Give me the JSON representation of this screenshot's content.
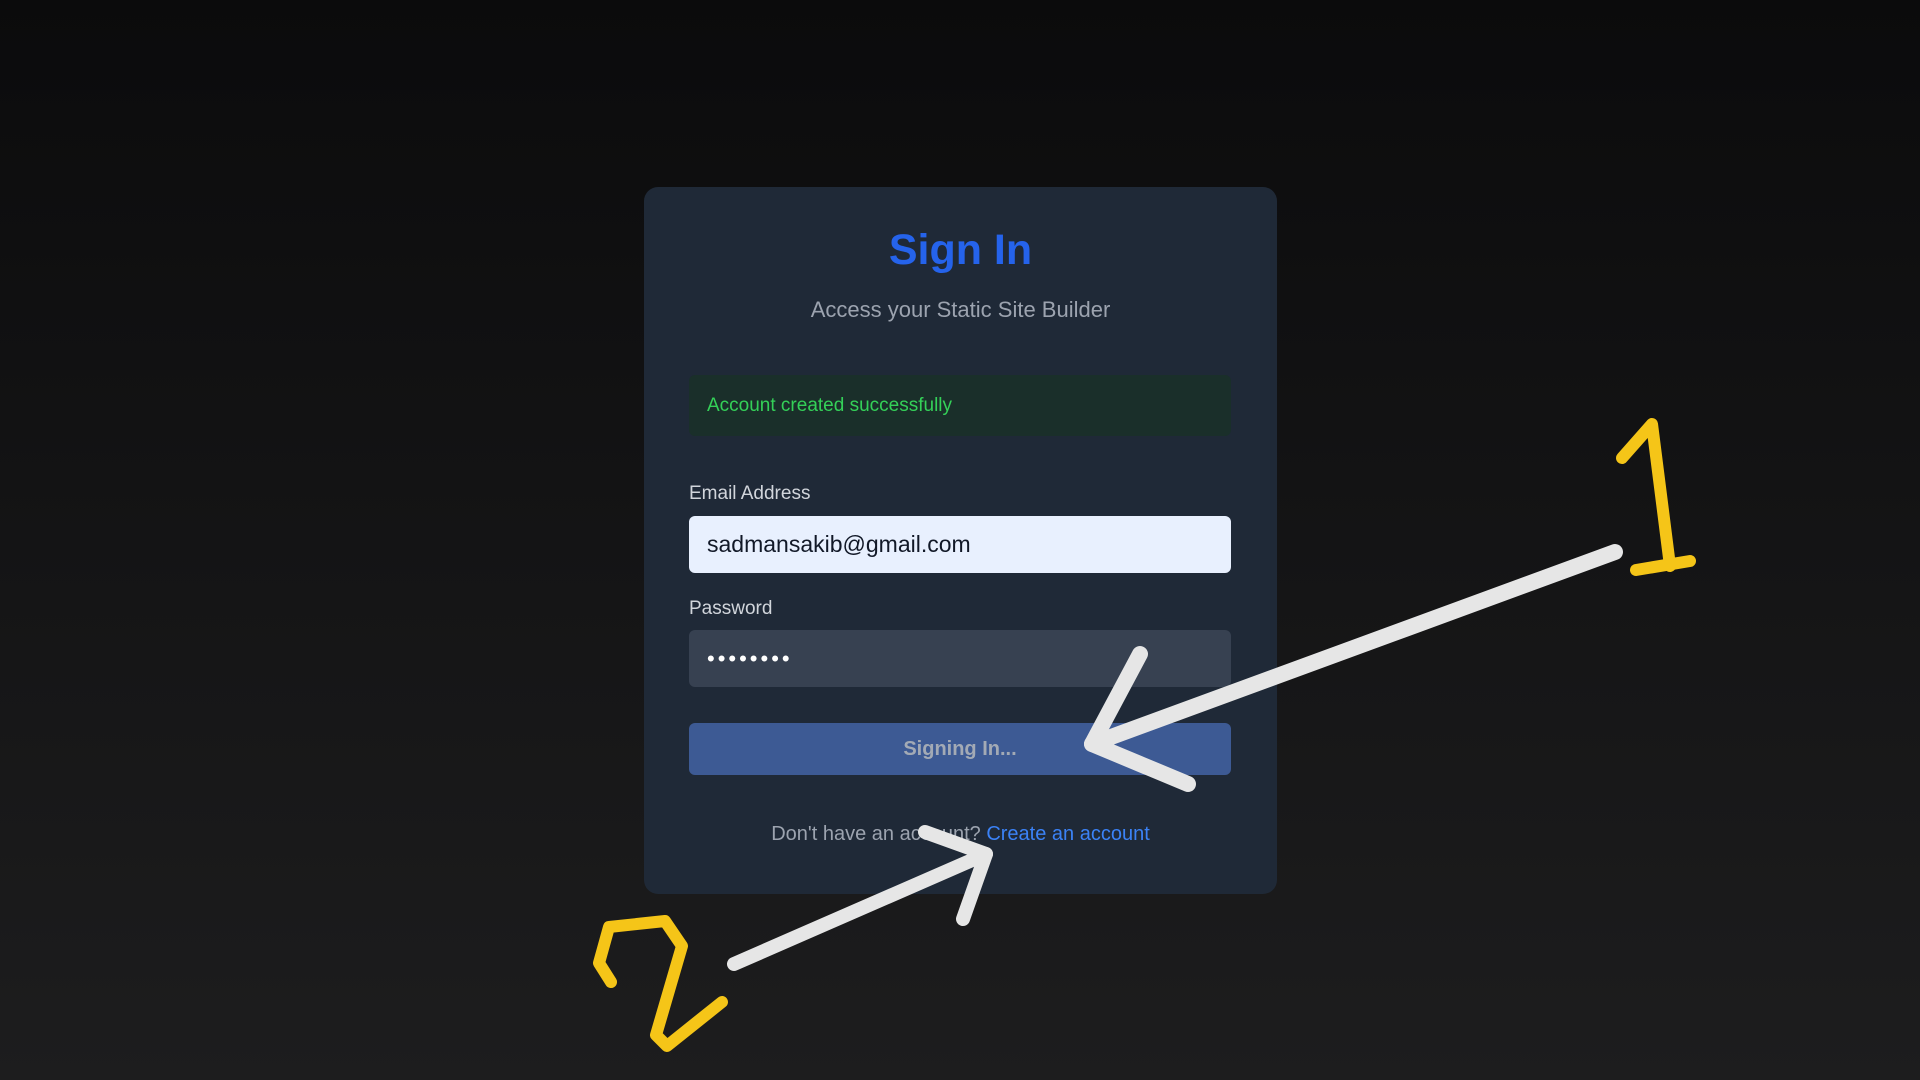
{
  "signin": {
    "title": "Sign In",
    "subtitle": "Access your Static Site Builder",
    "alert": "Account created successfully",
    "email_label": "Email Address",
    "email_value": "sadmansakib@gmail.com",
    "password_label": "Password",
    "password_value": "12345678",
    "submit_label": "Signing In...",
    "footer_text": "Don't have an account?",
    "footer_link": "Create an account"
  },
  "annotations": {
    "arrow_1_label": "1",
    "arrow_2_label": "2"
  },
  "colors": {
    "accent": "#2563eb",
    "success": "#34d058",
    "annotation_arrow": "#e6e6e6",
    "annotation_number": "#f5c518"
  }
}
